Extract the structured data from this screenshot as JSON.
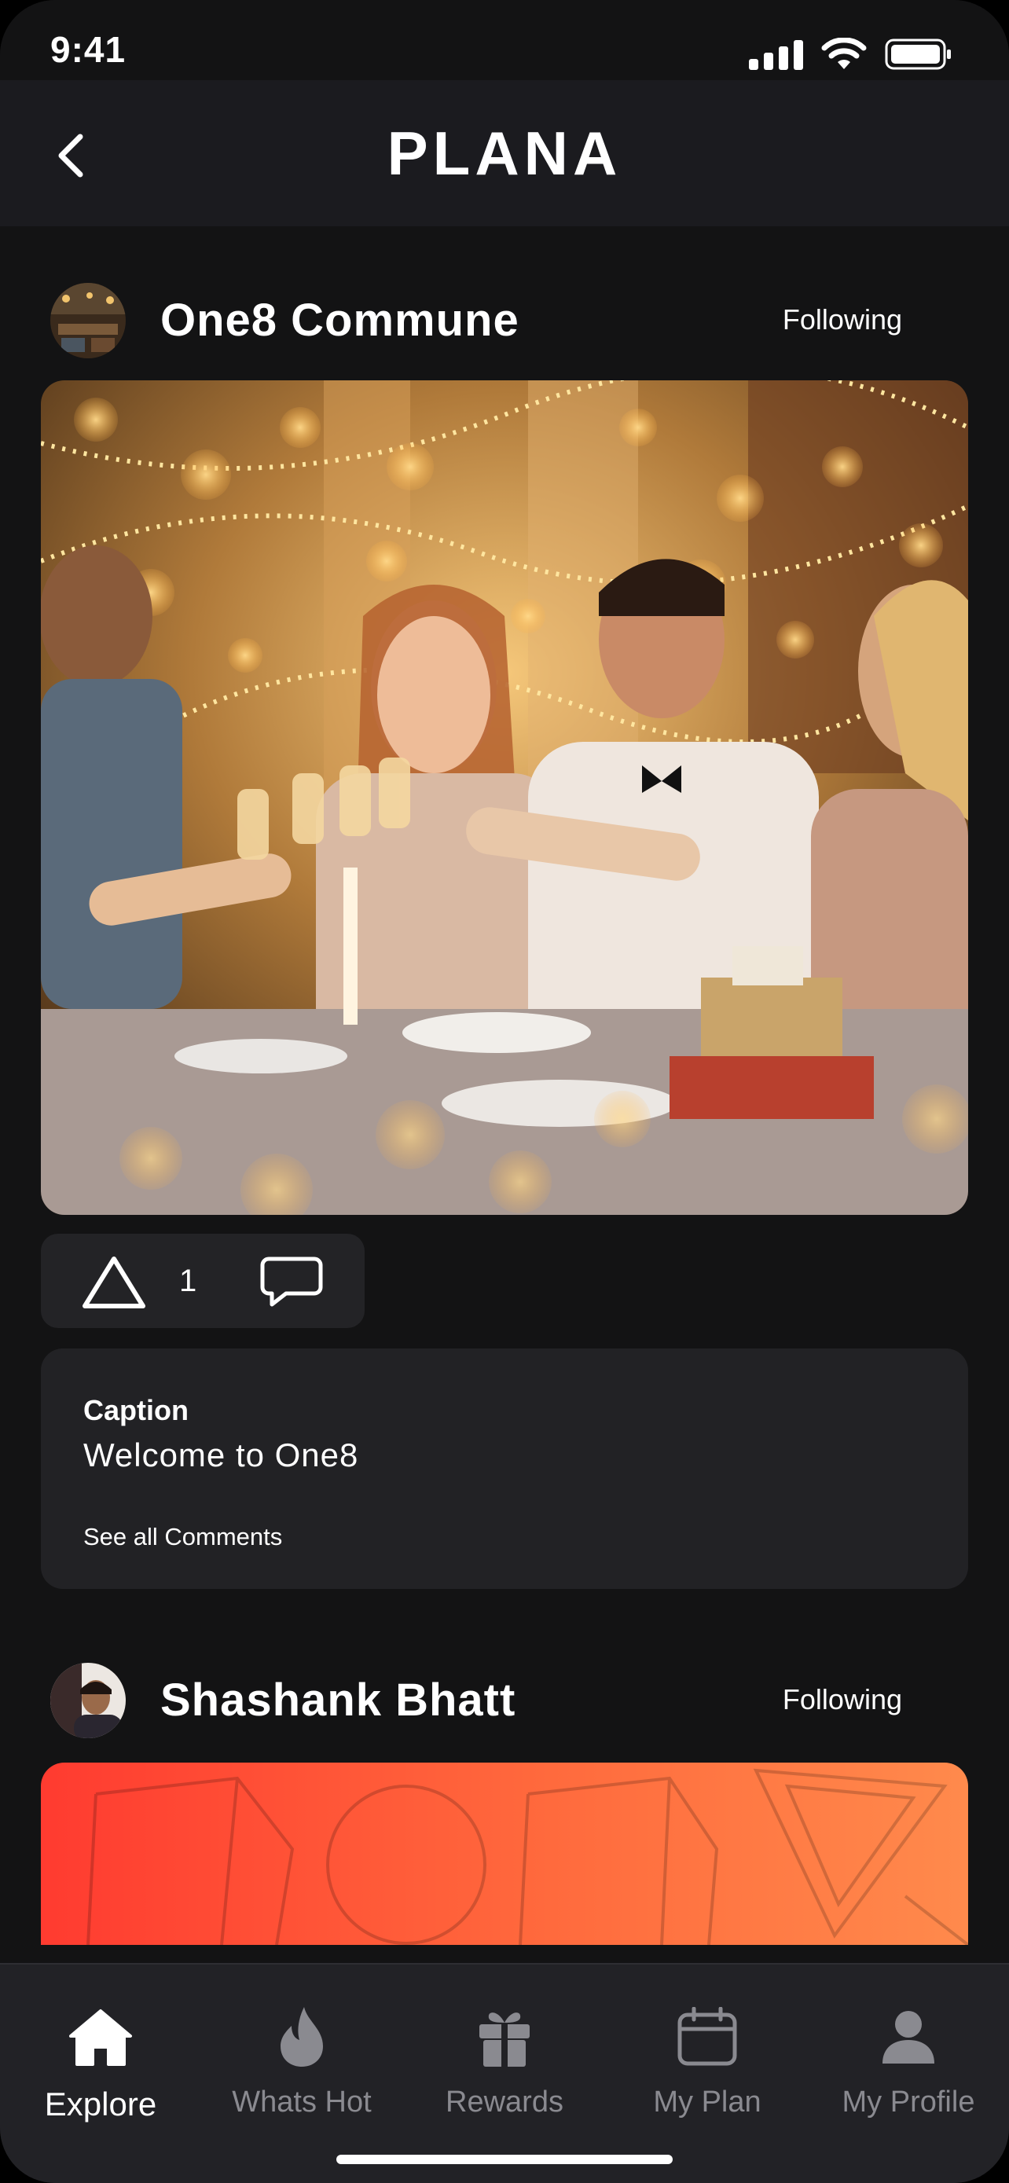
{
  "status": {
    "time": "9:41"
  },
  "header": {
    "logo": "PLANA",
    "back_icon": "chevron-left-icon"
  },
  "posts": [
    {
      "author": "One8 Commune",
      "follow_label": "Following",
      "likes": "1",
      "caption_label": "Caption",
      "caption": "Welcome to One8",
      "comments_link": "See all Comments"
    },
    {
      "author": "Shashank Bhatt",
      "follow_label": "Following"
    }
  ],
  "tabs": [
    {
      "label": "Explore",
      "icon": "home-icon",
      "active": true
    },
    {
      "label": "Whats Hot",
      "icon": "flame-icon",
      "active": false
    },
    {
      "label": "Rewards",
      "icon": "gift-icon",
      "active": false
    },
    {
      "label": "My Plan",
      "icon": "calendar-icon",
      "active": false
    },
    {
      "label": "My Profile",
      "icon": "user-icon",
      "active": false
    }
  ],
  "colors": {
    "background": "#131314",
    "header": "#1b1b1f",
    "card": "#222225",
    "accent_gradient_start": "#ff3b30",
    "accent_gradient_end": "#ff8a4c"
  }
}
